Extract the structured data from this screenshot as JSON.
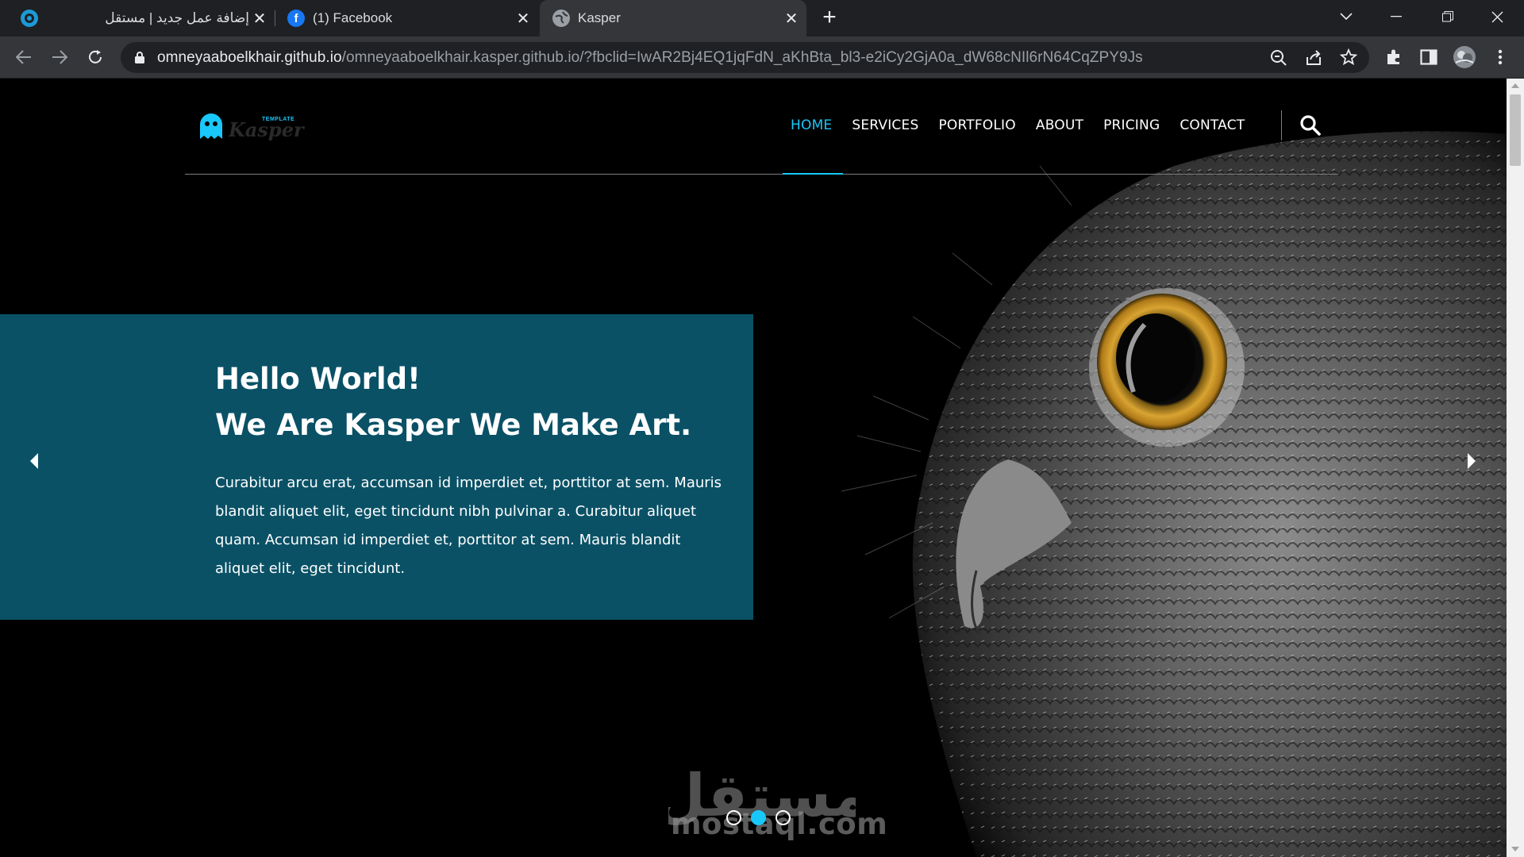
{
  "browser": {
    "tabs": [
      {
        "title": "إضافة عمل جديد | مستقل",
        "favicon": "mostaql-favicon"
      },
      {
        "title": "(1) Facebook",
        "favicon": "facebook-favicon"
      },
      {
        "title": "Kasper",
        "favicon": "globe-favicon",
        "active": true
      }
    ],
    "url_host": "omneyaaboelkhair.github.io",
    "url_path": "/omneyaaboelkhair.kasper.github.io/?fbclid=IwAR2Bj4EQ1jqFdN_aKhBta_bl3-e2iCy2GjA0a_dW68cNIl6rN64CqZPY9Js"
  },
  "site": {
    "logo_text": "Kasper",
    "logo_tag": "TEMPLATE",
    "nav": [
      "HOME",
      "SERVICES",
      "PORTFOLIO",
      "ABOUT",
      "PRICING",
      "CONTACT"
    ],
    "nav_active": "HOME",
    "hero": {
      "title_line1": "Hello World!",
      "title_line2": "We Are Kasper We Make Art.",
      "body": "Curabitur arcu erat, accumsan id imperdiet et, porttitor at sem. Mauris blandit aliquet elit, eget tincidunt nibh pulvinar a. Curabitur aliquet quam. Accumsan id imperdiet et, porttitor at sem. Mauris blandit aliquet elit, eget tincidunt."
    },
    "slider": {
      "count": 3,
      "active_index": 1
    }
  },
  "watermark": {
    "arabic": "مستقل",
    "latin": "mostaql.com"
  },
  "colors": {
    "accent": "#19c8fa",
    "hero_box": "#0a5166",
    "chrome_dark": "#1f2024",
    "chrome": "#35363a"
  }
}
